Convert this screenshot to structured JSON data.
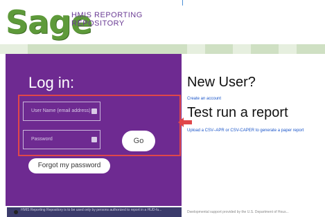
{
  "logo": {
    "word": "Sage",
    "subtitle_line1": "HMIS REPORTING",
    "subtitle_line2": "REPOSITORY"
  },
  "login": {
    "title": "Log in:",
    "username_placeholder": "User Name (email address)",
    "password_placeholder": "Password",
    "go_label": "Go",
    "forgot_label": "Forgot my password"
  },
  "new_user": {
    "title": "New User?",
    "create_link": "Create an account"
  },
  "test_run": {
    "title": "Test run a report",
    "upload_link": "Upload a CSV–APR or CSV-CAPER to generate a paper report"
  },
  "footer": {
    "left_text": "HMIS Reporting Repository is to be used only by persons authorized to report in a HUD-fu...",
    "right_text": "Dwelopmental support provided by the U.S. Department of Hous..."
  },
  "colors": {
    "purple": "#6e2a91",
    "green": "#5e9a3a",
    "highlight": "#e0474a",
    "link": "#1a55c9"
  }
}
